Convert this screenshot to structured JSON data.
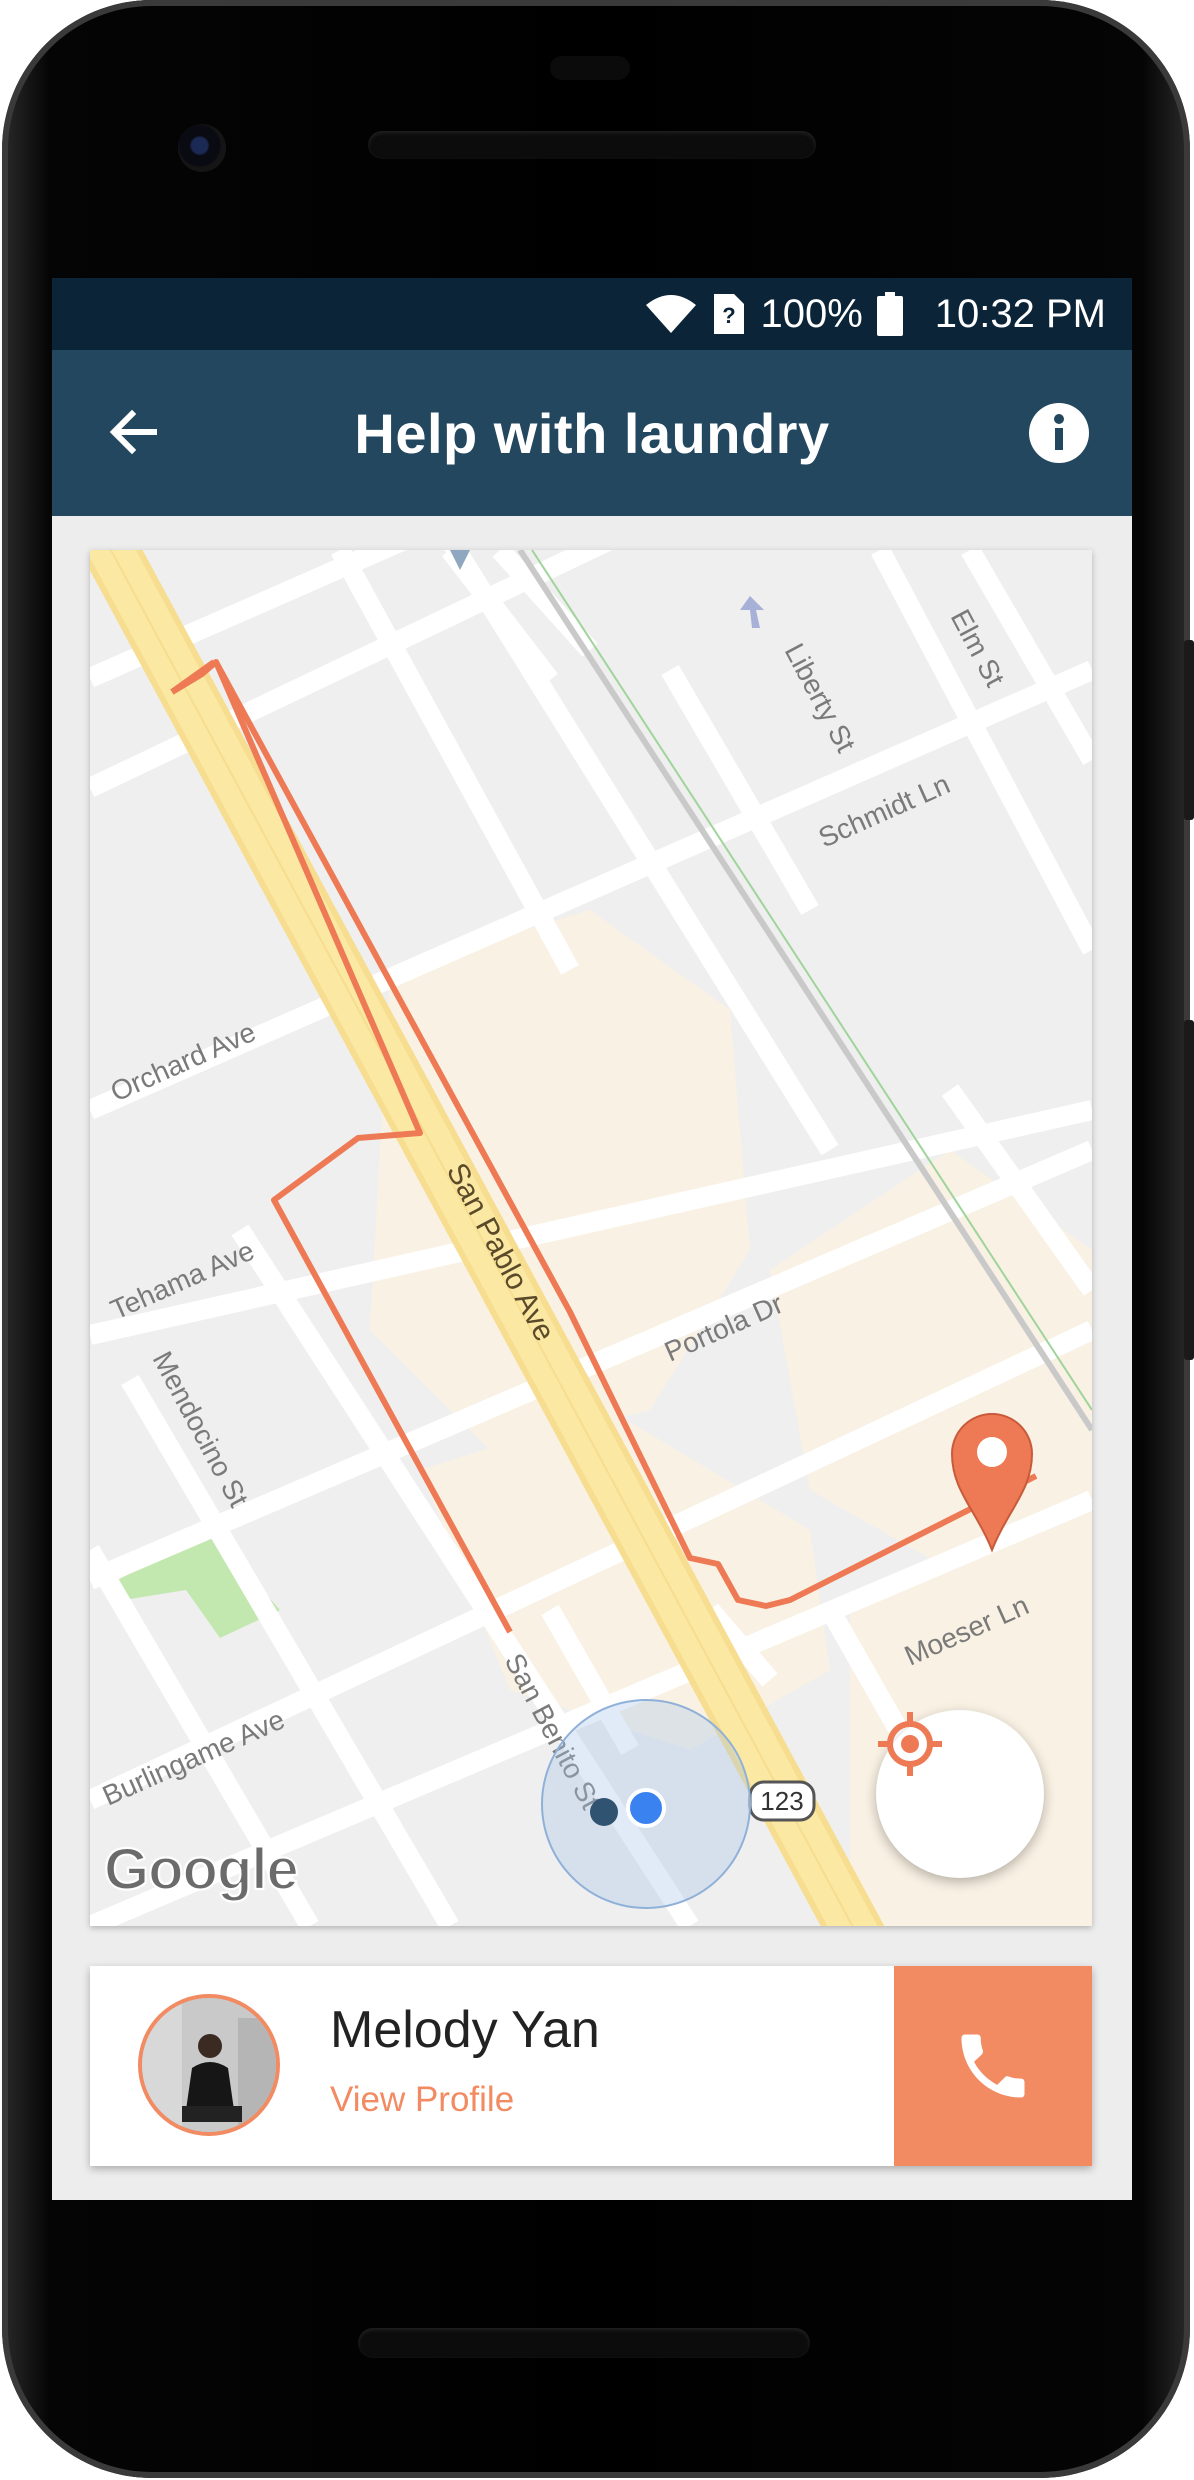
{
  "status_bar": {
    "battery": "100%",
    "time": "10:32 PM",
    "icons": [
      "wifi-icon",
      "sim-unknown-icon",
      "battery-icon"
    ]
  },
  "app_bar": {
    "title": "Help with laundry",
    "back_icon": "arrow-back-icon",
    "info_icon": "info-icon",
    "color": "#22475e"
  },
  "map": {
    "streets": {
      "san_pablo": "San Pablo Ave",
      "orchard": "Orchard Ave",
      "tehama": "Tehama Ave",
      "mendocino": "Mendocino St",
      "burlingame": "Burlingame Ave",
      "san_benito": "San Benito St",
      "liberty": "Liberty St",
      "elm": "Elm St",
      "schmidt": "Schmidt Ln",
      "portola": "Portola Dr",
      "moeser": "Moeser Ln",
      "route_shield": "123"
    },
    "logo": "Google",
    "route_color": "#ee7a55",
    "destination_icon": "map-pin-icon",
    "current_location_icon": "blue-dot-icon"
  },
  "locate_button": {
    "icon": "my-location-icon"
  },
  "profile": {
    "name": "Melody Yan",
    "link_label": "View Profile",
    "call_icon": "phone-icon",
    "accent": "#f28a62"
  }
}
